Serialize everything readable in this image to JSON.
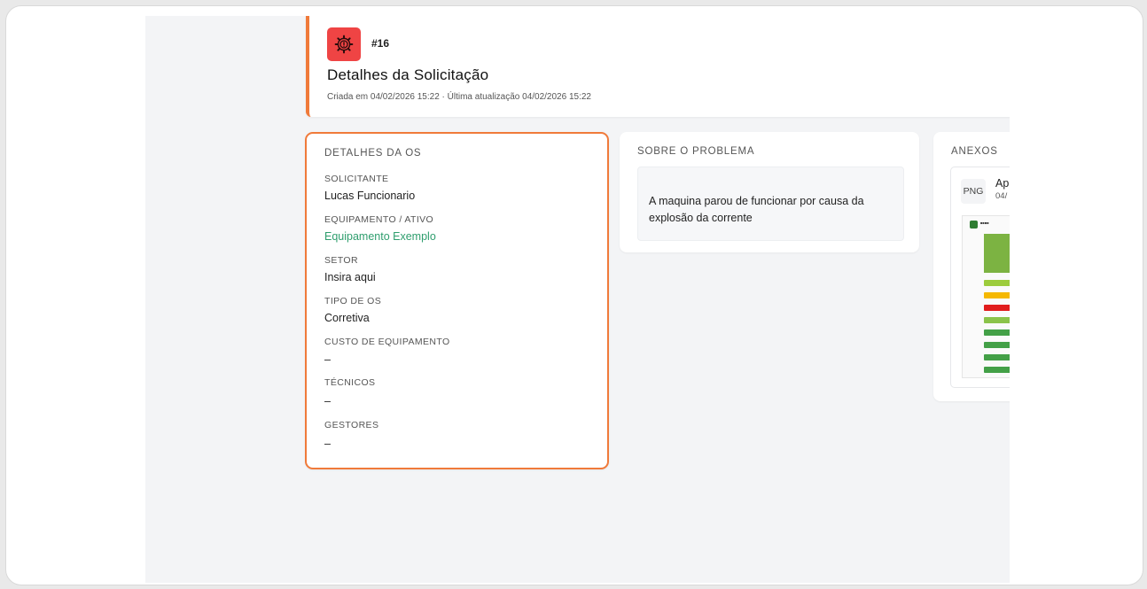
{
  "header": {
    "ticket_number": "#16",
    "title": "Detalhes da Solicitação",
    "meta": "Criada em 04/02/2026 15:22 · Última atualização 04/02/2026 15:22",
    "status_icon": "gear-alert-icon",
    "accent_color": "#f07a3a",
    "status_color": "#ef4444"
  },
  "details": {
    "title": "DETALHES DA OS",
    "fields": [
      {
        "label": "SOLICITANTE",
        "value": "Lucas Funcionario"
      },
      {
        "label": "EQUIPAMENTO / ATIVO",
        "value": "Equipamento Exemplo"
      },
      {
        "label": "SETOR",
        "value": "Insira aqui"
      },
      {
        "label": "TIPO DE OS",
        "value": "Corretiva"
      },
      {
        "label": "CUSTO DE EQUIPAMENTO",
        "value": "–"
      },
      {
        "label": "TÉCNICOS",
        "value": "–"
      },
      {
        "label": "GESTORES",
        "value": "–"
      }
    ],
    "link_color": "#2f9e6e"
  },
  "problem": {
    "title": "SOBRE O PROBLEMA",
    "description": "A maquina parou de funcionar por causa da explosão da corrente"
  },
  "attachments": {
    "title": "ANEXOS",
    "items": [
      {
        "type": "PNG",
        "name": "Ap",
        "date": "04/"
      }
    ]
  }
}
